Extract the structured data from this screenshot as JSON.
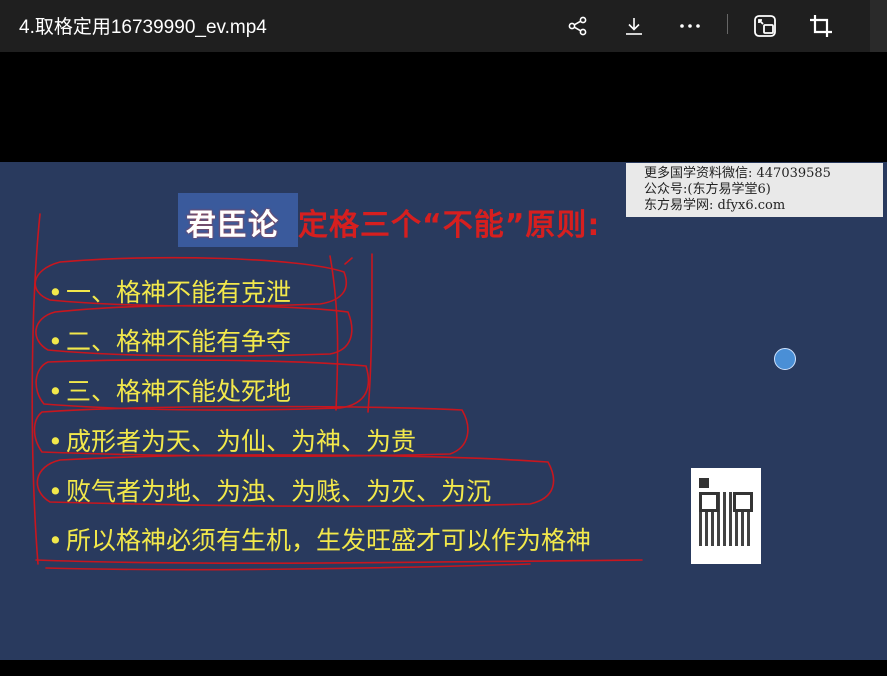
{
  "window": {
    "title": "4.取格定用16739990_ev.mp4"
  },
  "toolbar": {
    "share_icon": "share-icon",
    "download_icon": "download-icon",
    "more_icon": "more-icon",
    "pip_icon": "picture-in-picture-icon",
    "crop_icon": "crop-icon"
  },
  "slide": {
    "title_highlight": "君臣论",
    "title_rest": "定格三个“不能”原则:",
    "bullets": [
      "一、格神不能有克泄",
      "二、格神不能有争夺",
      "三、格神不能处死地",
      "成形者为天、为仙、为神、为贵",
      "败气者为地、为浊、为贱、为灭、为沉",
      "所以格神必须有生机，生发旺盛才可以作为格神"
    ],
    "bullet_glyph": "•"
  },
  "watermark": {
    "line1": "更多国学资料微信: 447039585",
    "line2": "公众号:(东方易学堂6)",
    "line3": "东方易学网: dfyx6.com"
  },
  "colors": {
    "slide_bg": "#293a5e",
    "bullet_text": "#f2e84b",
    "title_red": "#d61f1f",
    "ink_red": "#c8161e"
  }
}
